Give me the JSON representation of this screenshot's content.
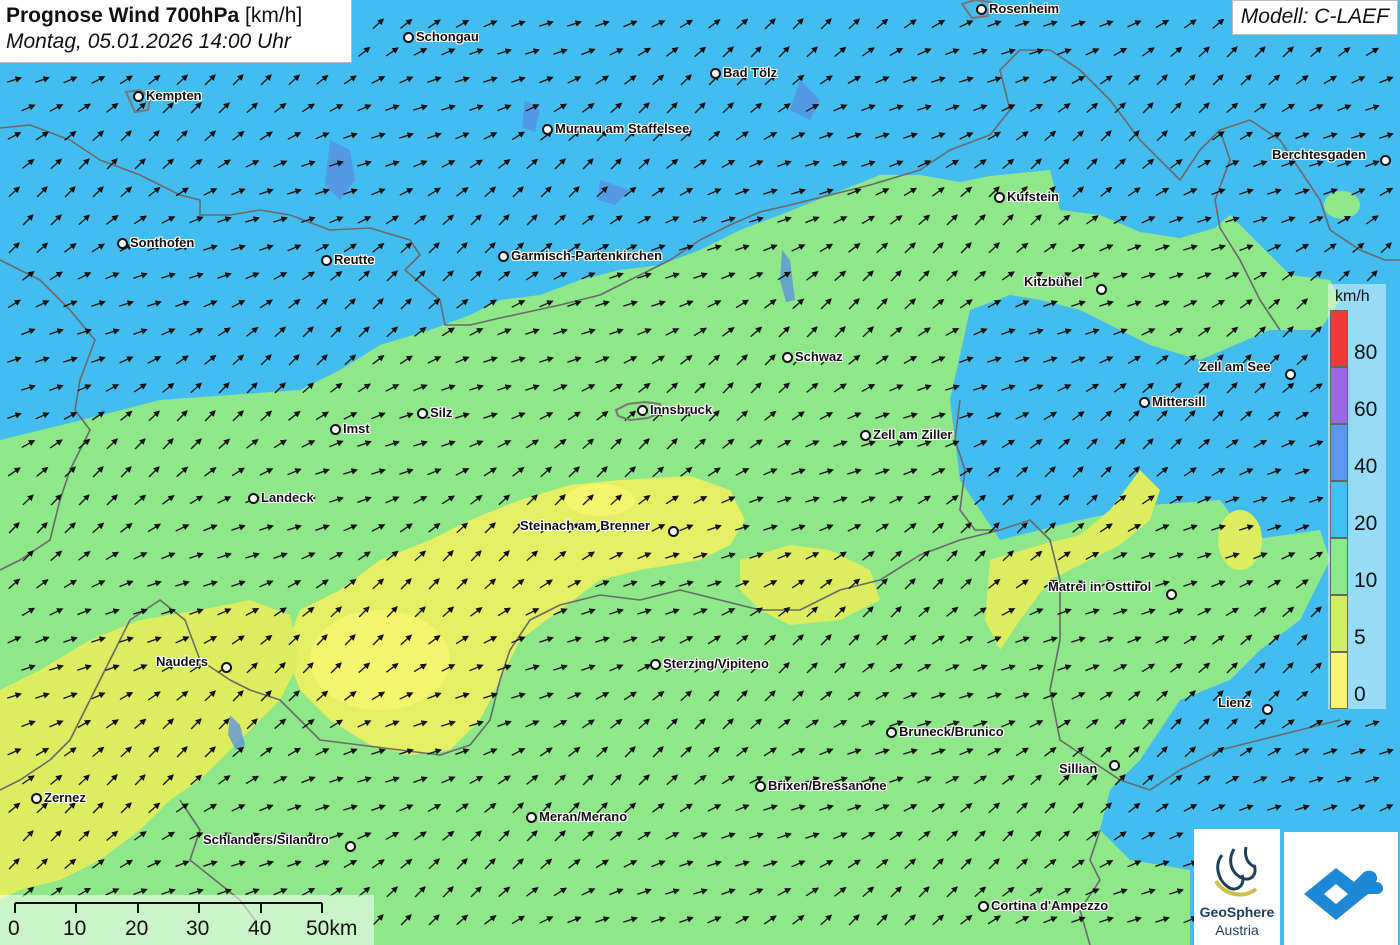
{
  "header": {
    "title_bold": "Prognose Wind 700hPa",
    "title_unit": "[km/h]",
    "subtitle": "Montag, 05.01.2026 14:00 Uhr",
    "model": "Modell: C-LAEF"
  },
  "cities": [
    {
      "name": "Rosenheim",
      "label_side": "right"
    },
    {
      "name": "Schongau",
      "label_side": "right"
    },
    {
      "name": "Bad Tölz",
      "label_side": "right"
    },
    {
      "name": "Kempten",
      "label_side": "right"
    },
    {
      "name": "Murnau am Staffelsee",
      "label_side": "right"
    },
    {
      "name": "Berchtesgaden",
      "label_side": "left"
    },
    {
      "name": "Kufstein",
      "label_side": "right"
    },
    {
      "name": "Sonthofen",
      "label_side": "right"
    },
    {
      "name": "Reutte",
      "label_side": "right"
    },
    {
      "name": "Garmisch-Partenkirchen",
      "label_side": "right"
    },
    {
      "name": "Kitzbühel",
      "label_side": "left"
    },
    {
      "name": "Schwaz",
      "label_side": "right"
    },
    {
      "name": "Zell am See",
      "label_side": "left"
    },
    {
      "name": "Mittersill",
      "label_side": "right"
    },
    {
      "name": "Silz",
      "label_side": "right"
    },
    {
      "name": "Innsbruck",
      "label_side": "right"
    },
    {
      "name": "Imst",
      "label_side": "right"
    },
    {
      "name": "Zell am Ziller",
      "label_side": "right"
    },
    {
      "name": "Landeck",
      "label_side": "right"
    },
    {
      "name": "Steinach am Brenner",
      "label_side": "left"
    },
    {
      "name": "Matrei in Osttirol",
      "label_side": "left"
    },
    {
      "name": "Nauders",
      "label_side": "left"
    },
    {
      "name": "Sterzing/Vipiteno",
      "label_side": "right"
    },
    {
      "name": "Lienz",
      "label_side": "left"
    },
    {
      "name": "Bruneck/Brunico",
      "label_side": "right"
    },
    {
      "name": "Sillian",
      "label_side": "left"
    },
    {
      "name": "Brixen/Bressanone",
      "label_side": "right"
    },
    {
      "name": "Zernez",
      "label_side": "right"
    },
    {
      "name": "Meran/Merano",
      "label_side": "right"
    },
    {
      "name": "Schlanders/Silandro",
      "label_side": "left"
    },
    {
      "name": "Cortina d'Ampezzo",
      "label_side": "right"
    }
  ],
  "legend": {
    "unit": "km/h",
    "classes": [
      {
        "label": "80",
        "color": "#f03a3a"
      },
      {
        "label": "60",
        "color": "#9a67e6"
      },
      {
        "label": "40",
        "color": "#5f95ee"
      },
      {
        "label": "20",
        "color": "#3ec4f0"
      },
      {
        "label": "10",
        "color": "#8ee788"
      },
      {
        "label": "5",
        "color": "#d2ef5d"
      },
      {
        "label": "0",
        "color": "#fbf46f"
      }
    ]
  },
  "wind": {
    "direction": "south-west to north-east (arrows point NE)"
  },
  "scalebar": {
    "ticks": [
      "0",
      "10",
      "20",
      "30",
      "40",
      "50km"
    ]
  },
  "logos": {
    "geosphere_line1": "GeoSphere",
    "geosphere_line2": "Austria",
    "geosphere_icon": "geosphere-swirl-icon",
    "partner_icon": "cloud-roof-icon",
    "brand_color": "#1c3e5c",
    "partner_color": "#1e88d8"
  }
}
